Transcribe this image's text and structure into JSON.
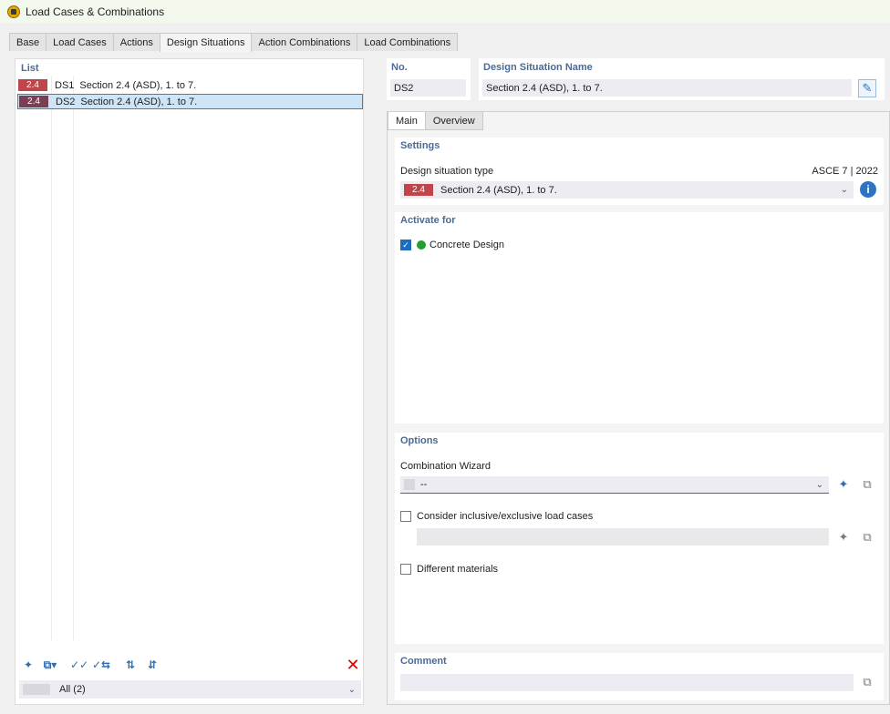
{
  "window": {
    "title": "Load Cases & Combinations",
    "icon": "app-icon"
  },
  "tabs": [
    {
      "label": "Base"
    },
    {
      "label": "Load Cases"
    },
    {
      "label": "Actions"
    },
    {
      "label": "Design Situations",
      "active": true
    },
    {
      "label": "Action Combinations"
    },
    {
      "label": "Load Combinations"
    }
  ],
  "list": {
    "title": "List",
    "items": [
      {
        "badge": "2.4",
        "no": "DS1",
        "name": "Section 2.4 (ASD), 1. to 7."
      },
      {
        "badge": "2.4",
        "no": "DS2",
        "name": "Section 2.4 (ASD), 1. to 7.",
        "selected": true
      }
    ],
    "filter": "All (2)",
    "delete_icon": "delete-icon"
  },
  "detail": {
    "no_label": "No.",
    "no_value": "DS2",
    "name_label": "Design Situation Name",
    "name_value": "Section 2.4 (ASD), 1. to 7.",
    "subtabs": [
      {
        "label": "Main",
        "active": true
      },
      {
        "label": "Overview"
      }
    ],
    "settings": {
      "title": "Settings",
      "type_label": "Design situation type",
      "standard": "ASCE 7 | 2022",
      "type_badge": "2.4",
      "type_value": "Section 2.4 (ASD), 1. to 7."
    },
    "activate": {
      "title": "Activate for",
      "items": [
        {
          "label": "Concrete Design",
          "checked": true
        }
      ]
    },
    "options": {
      "title": "Options",
      "wizard_label": "Combination Wizard",
      "wizard_value": "--",
      "inclusive_label": "Consider inclusive/exclusive load cases",
      "materials_label": "Different materials"
    },
    "comment": {
      "title": "Comment",
      "value": ""
    }
  },
  "colors": {
    "badge": "#c0454a",
    "selected_badge": "#7a3f53",
    "accent": "#4c6a92",
    "delete": "#e00000"
  }
}
